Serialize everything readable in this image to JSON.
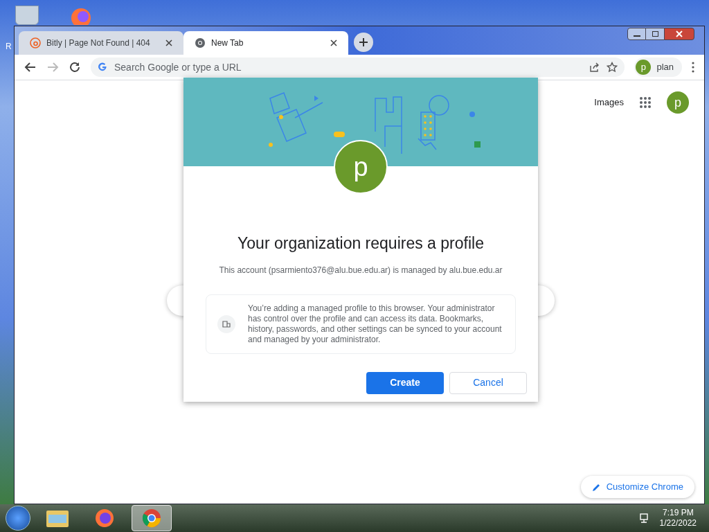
{
  "desktop": {
    "icon_label": "R"
  },
  "tabs": [
    {
      "title": "Bitly | Page Not Found | 404",
      "selected": false
    },
    {
      "title": "New Tab",
      "selected": true
    }
  ],
  "omnibox": {
    "placeholder": "Search Google or type a URL"
  },
  "profile_chip": {
    "initial": "p",
    "name": "plan"
  },
  "ntp": {
    "link": "Images",
    "avatar": "p",
    "customize": "Customize Chrome"
  },
  "dialog": {
    "avatar": "p",
    "title": "Your organization requires a profile",
    "subtitle": "This account (psarmiento376@alu.bue.edu.ar) is managed by alu.bue.edu.ar",
    "notice": "You’re adding a managed profile to this browser. Your administrator has control over the profile and can access its data. Bookmarks, history, passwords, and other settings can be synced to your account and managed by your administrator.",
    "buttons": [
      {
        "label": "Create",
        "kind": "primary"
      },
      {
        "label": "Cancel",
        "kind": "secondary"
      }
    ]
  },
  "taskbar": {
    "apps": [
      {
        "selected": false
      },
      {
        "selected": false
      },
      {
        "selected": true
      }
    ],
    "time": "7:19 PM",
    "date": "1/22/2022"
  }
}
